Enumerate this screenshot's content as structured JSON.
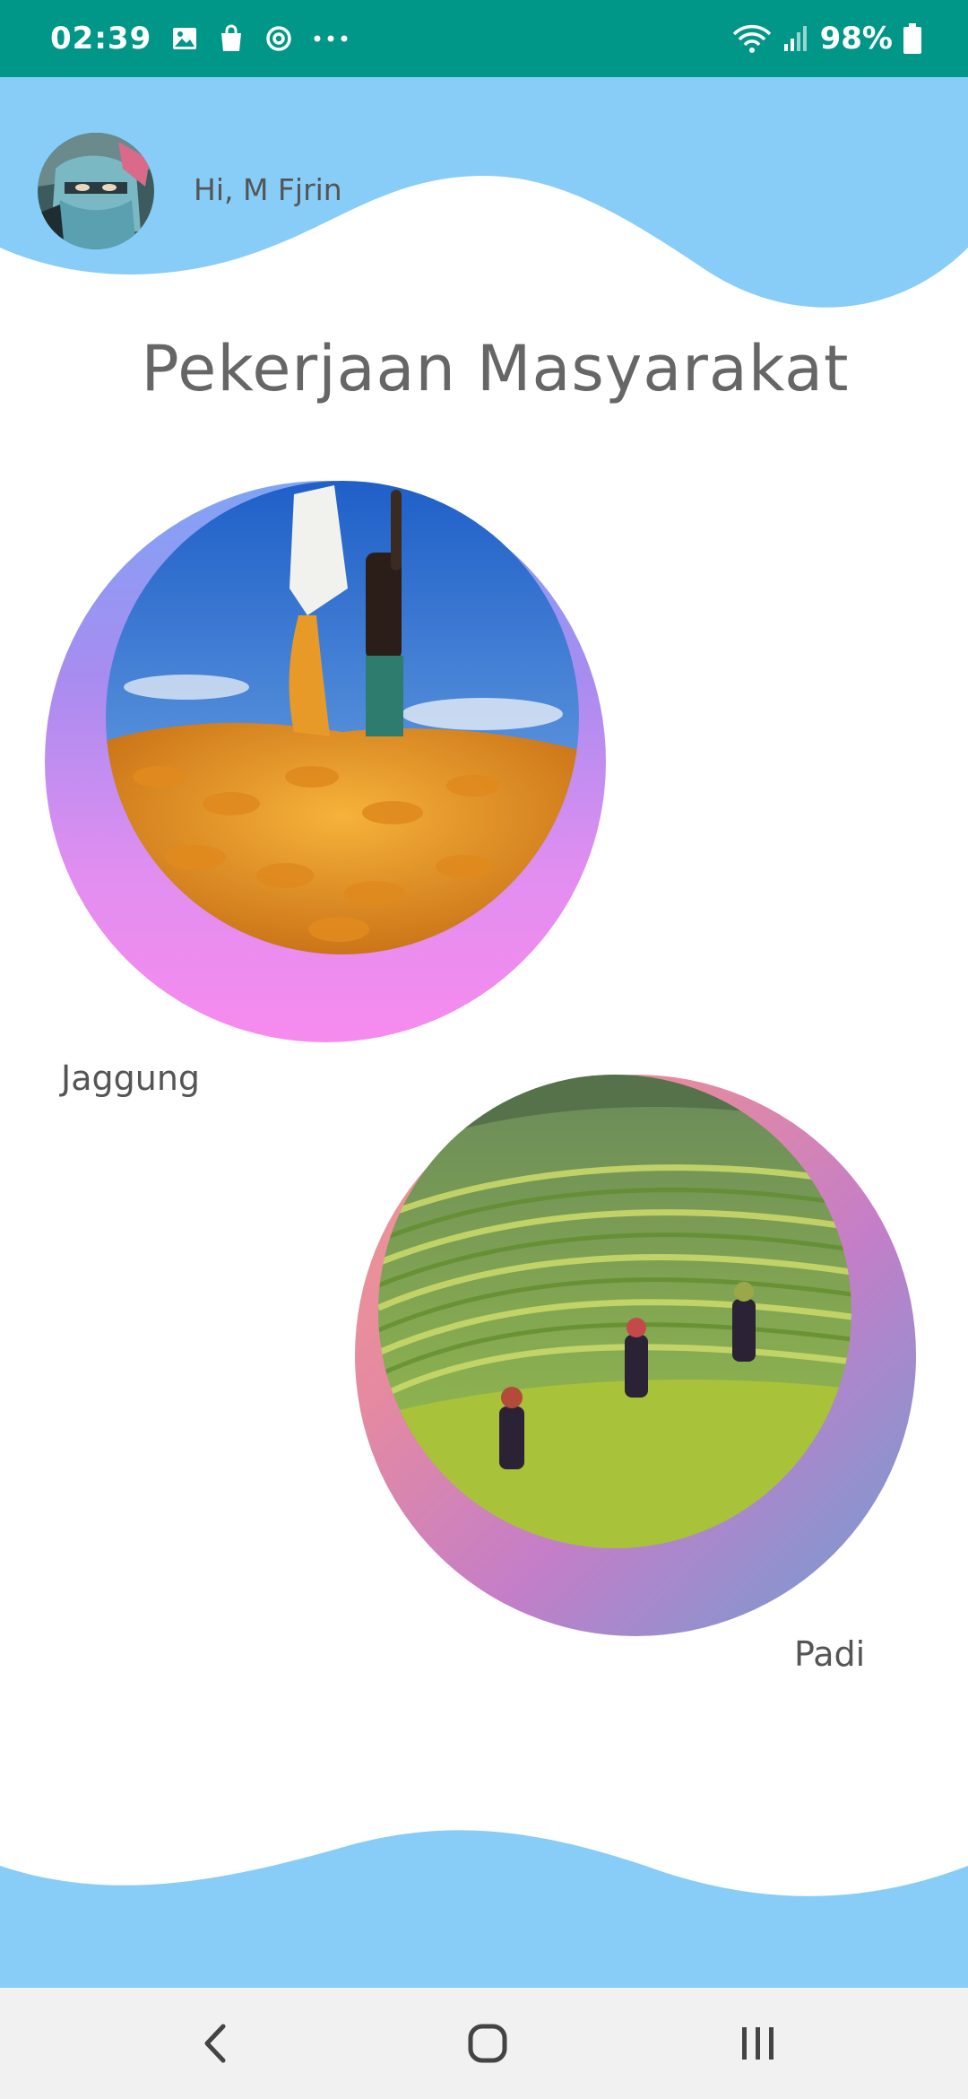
{
  "status_bar": {
    "time": "02:39",
    "battery": "98%",
    "left_icons": [
      "image-icon",
      "shopping-bag-icon",
      "sync-icon",
      "more-dots-icon"
    ],
    "right_icons": [
      "wifi-icon",
      "signal-icon",
      "battery-icon"
    ]
  },
  "header": {
    "greeting": "Hi, M Fjrin"
  },
  "main": {
    "title": "Pekerjaan Masyarakat",
    "cards": [
      {
        "label": "Jaggung",
        "image": "corn-harvest-photo"
      },
      {
        "label": "Padi",
        "image": "rice-terrace-photo"
      }
    ]
  },
  "nav_bar": {
    "buttons": [
      "back-icon",
      "home-icon",
      "recent-apps-icon"
    ]
  },
  "colors": {
    "status_bar": "#009688",
    "wave": "#87cdf7",
    "title_text": "#666666",
    "nav_bar": "#f1f1f1"
  }
}
